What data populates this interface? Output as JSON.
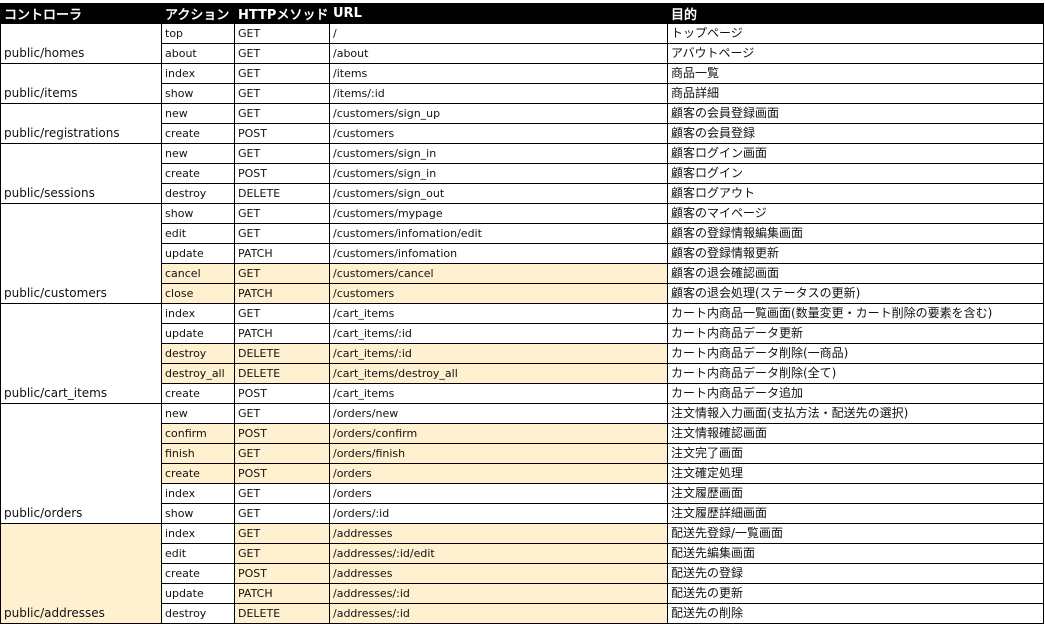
{
  "headers": [
    "コントローラ",
    "アクション",
    "HTTPメソッド",
    "URL",
    "目的"
  ],
  "controllers": [
    {
      "name": "public/homes",
      "highlight": false,
      "routes": [
        {
          "action": "top",
          "method": "GET",
          "url": "/",
          "purpose": "トップページ",
          "hl": [
            false,
            false,
            false
          ]
        },
        {
          "action": "about",
          "method": "GET",
          "url": "/about",
          "purpose": "アバウトページ",
          "hl": [
            false,
            false,
            false
          ]
        }
      ]
    },
    {
      "name": "public/items",
      "highlight": false,
      "routes": [
        {
          "action": "index",
          "method": "GET",
          "url": "/items",
          "purpose": "商品一覧",
          "hl": [
            false,
            false,
            false
          ]
        },
        {
          "action": "show",
          "method": "GET",
          "url": "/items/:id",
          "purpose": "商品詳細",
          "hl": [
            false,
            false,
            false
          ]
        }
      ]
    },
    {
      "name": "public/registrations",
      "highlight": false,
      "routes": [
        {
          "action": "new",
          "method": "GET",
          "url": "/customers/sign_up",
          "purpose": "顧客の会員登録画面",
          "hl": [
            false,
            false,
            false
          ]
        },
        {
          "action": "create",
          "method": "POST",
          "url": "/customers",
          "purpose": "顧客の会員登録",
          "hl": [
            false,
            false,
            false
          ]
        }
      ]
    },
    {
      "name": "public/sessions",
      "highlight": false,
      "routes": [
        {
          "action": "new",
          "method": "GET",
          "url": "/customers/sign_in",
          "purpose": "顧客ログイン画面",
          "hl": [
            false,
            false,
            false
          ]
        },
        {
          "action": "create",
          "method": "POST",
          "url": "/customers/sign_in",
          "purpose": "顧客ログイン",
          "hl": [
            false,
            false,
            false
          ]
        },
        {
          "action": "destroy",
          "method": "DELETE",
          "url": "/customers/sign_out",
          "purpose": "顧客ログアウト",
          "hl": [
            false,
            false,
            false
          ]
        }
      ]
    },
    {
      "name": "public/customers",
      "highlight": false,
      "routes": [
        {
          "action": "show",
          "method": "GET",
          "url": "/customers/mypage",
          "purpose": "顧客のマイページ",
          "hl": [
            false,
            false,
            true
          ]
        },
        {
          "action": "edit",
          "method": "GET",
          "url": "/customers/infomation/edit",
          "purpose": "顧客の登録情報編集画面",
          "hl": [
            false,
            false,
            true
          ]
        },
        {
          "action": "update",
          "method": "PATCH",
          "url": "/customers/infomation",
          "purpose": "顧客の登録情報更新",
          "hl": [
            false,
            false,
            true
          ]
        },
        {
          "action": "cancel",
          "method": "GET",
          "url": "/customers/cancel",
          "purpose": "顧客の退会確認画面",
          "hl": [
            true,
            true,
            true
          ]
        },
        {
          "action": "close",
          "method": "PATCH",
          "url": "/customers",
          "purpose": "顧客の退会処理(ステータスの更新)",
          "hl": [
            true,
            true,
            true
          ]
        }
      ]
    },
    {
      "name": "public/cart_items",
      "highlight": false,
      "routes": [
        {
          "action": "index",
          "method": "GET",
          "url": "/cart_items",
          "purpose": "カート内商品一覧画面(数量変更・カート削除の要素を含む)",
          "hl": [
            false,
            false,
            false
          ]
        },
        {
          "action": "update",
          "method": "PATCH",
          "url": "/cart_items/:id",
          "purpose": "カート内商品データ更新",
          "hl": [
            false,
            false,
            false
          ]
        },
        {
          "action": "destroy",
          "method": "DELETE",
          "url": "/cart_items/:id",
          "purpose": "カート内商品データ削除(一商品)",
          "hl": [
            true,
            true,
            true
          ]
        },
        {
          "action": "destroy_all",
          "method": "DELETE",
          "url": "/cart_items/destroy_all",
          "purpose": "カート内商品データ削除(全て)",
          "hl": [
            true,
            true,
            true
          ]
        },
        {
          "action": "create",
          "method": "POST",
          "url": "/cart_items",
          "purpose": "カート内商品データ追加",
          "hl": [
            false,
            false,
            false
          ]
        }
      ]
    },
    {
      "name": "public/orders",
      "highlight": false,
      "routes": [
        {
          "action": "new",
          "method": "GET",
          "url": "/orders/new",
          "purpose": "注文情報入力画面(支払方法・配送先の選択)",
          "hl": [
            false,
            false,
            false
          ]
        },
        {
          "action": "confirm",
          "method": "POST",
          "url": "/orders/confirm",
          "purpose": "注文情報確認画面",
          "hl": [
            true,
            true,
            true
          ]
        },
        {
          "action": "finish",
          "method": "GET",
          "url": "/orders/finish",
          "purpose": "注文完了画面",
          "hl": [
            true,
            true,
            true
          ]
        },
        {
          "action": "create",
          "method": "POST",
          "url": "/orders",
          "purpose": "注文確定処理",
          "hl": [
            true,
            true,
            true
          ]
        },
        {
          "action": "index",
          "method": "GET",
          "url": "/orders",
          "purpose": "注文履歴画面",
          "hl": [
            false,
            false,
            false
          ]
        },
        {
          "action": "show",
          "method": "GET",
          "url": "/orders/:id",
          "purpose": "注文履歴詳細画面",
          "hl": [
            false,
            false,
            false
          ]
        }
      ]
    },
    {
      "name": "public/addresses",
      "highlight": true,
      "routes": [
        {
          "action": "index",
          "method": "GET",
          "url": "/addresses",
          "purpose": "配送先登録/一覧画面",
          "hl": [
            false,
            true,
            true
          ]
        },
        {
          "action": "edit",
          "method": "GET",
          "url": "/addresses/:id/edit",
          "purpose": "配送先編集画面",
          "hl": [
            false,
            true,
            true
          ]
        },
        {
          "action": "create",
          "method": "POST",
          "url": "/addresses",
          "purpose": "配送先の登録",
          "hl": [
            false,
            true,
            true
          ]
        },
        {
          "action": "update",
          "method": "PATCH",
          "url": "/addresses/:id",
          "purpose": "配送先の更新",
          "hl": [
            false,
            true,
            true
          ]
        },
        {
          "action": "destroy",
          "method": "DELETE",
          "url": "/addresses/:id",
          "purpose": "配送先の削除",
          "hl": [
            false,
            true,
            true
          ]
        }
      ]
    }
  ]
}
